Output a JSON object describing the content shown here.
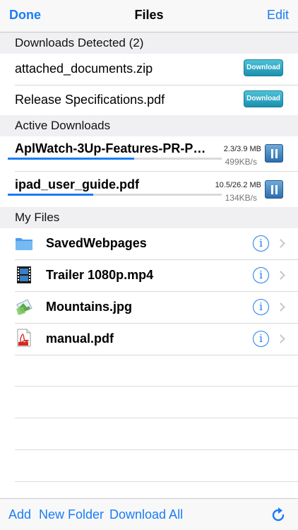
{
  "navbar": {
    "left": "Done",
    "title": "Files",
    "right": "Edit"
  },
  "sections": {
    "detected": "Downloads Detected (2)",
    "active": "Active Downloads",
    "my_files": "My Files"
  },
  "detected": [
    {
      "name": "attached_documents.zip",
      "button": "Download"
    },
    {
      "name": "Release Specifications.pdf",
      "button": "Download"
    }
  ],
  "active": [
    {
      "name": "AplWatch-3Up-Features-PR-PRI...",
      "size": "2.3/3.9 MB",
      "speed": "499KB/s",
      "progress": 0.59
    },
    {
      "name": "ipad_user_guide.pdf",
      "size": "10.5/26.2 MB",
      "speed": "134KB/s",
      "progress": 0.4
    }
  ],
  "files": [
    {
      "name": "SavedWebpages",
      "icon": "folder-icon"
    },
    {
      "name": "Trailer 1080p.mp4",
      "icon": "film-icon"
    },
    {
      "name": "Mountains.jpg",
      "icon": "image-icon"
    },
    {
      "name": "manual.pdf",
      "icon": "pdf-icon"
    }
  ],
  "toolbar": {
    "add": "Add",
    "new_folder": "New Folder",
    "download_all": "Download All"
  },
  "colors": {
    "accent": "#1a7cf5",
    "download_button": "#1b90ad",
    "pause_button": "#2d6fae"
  }
}
